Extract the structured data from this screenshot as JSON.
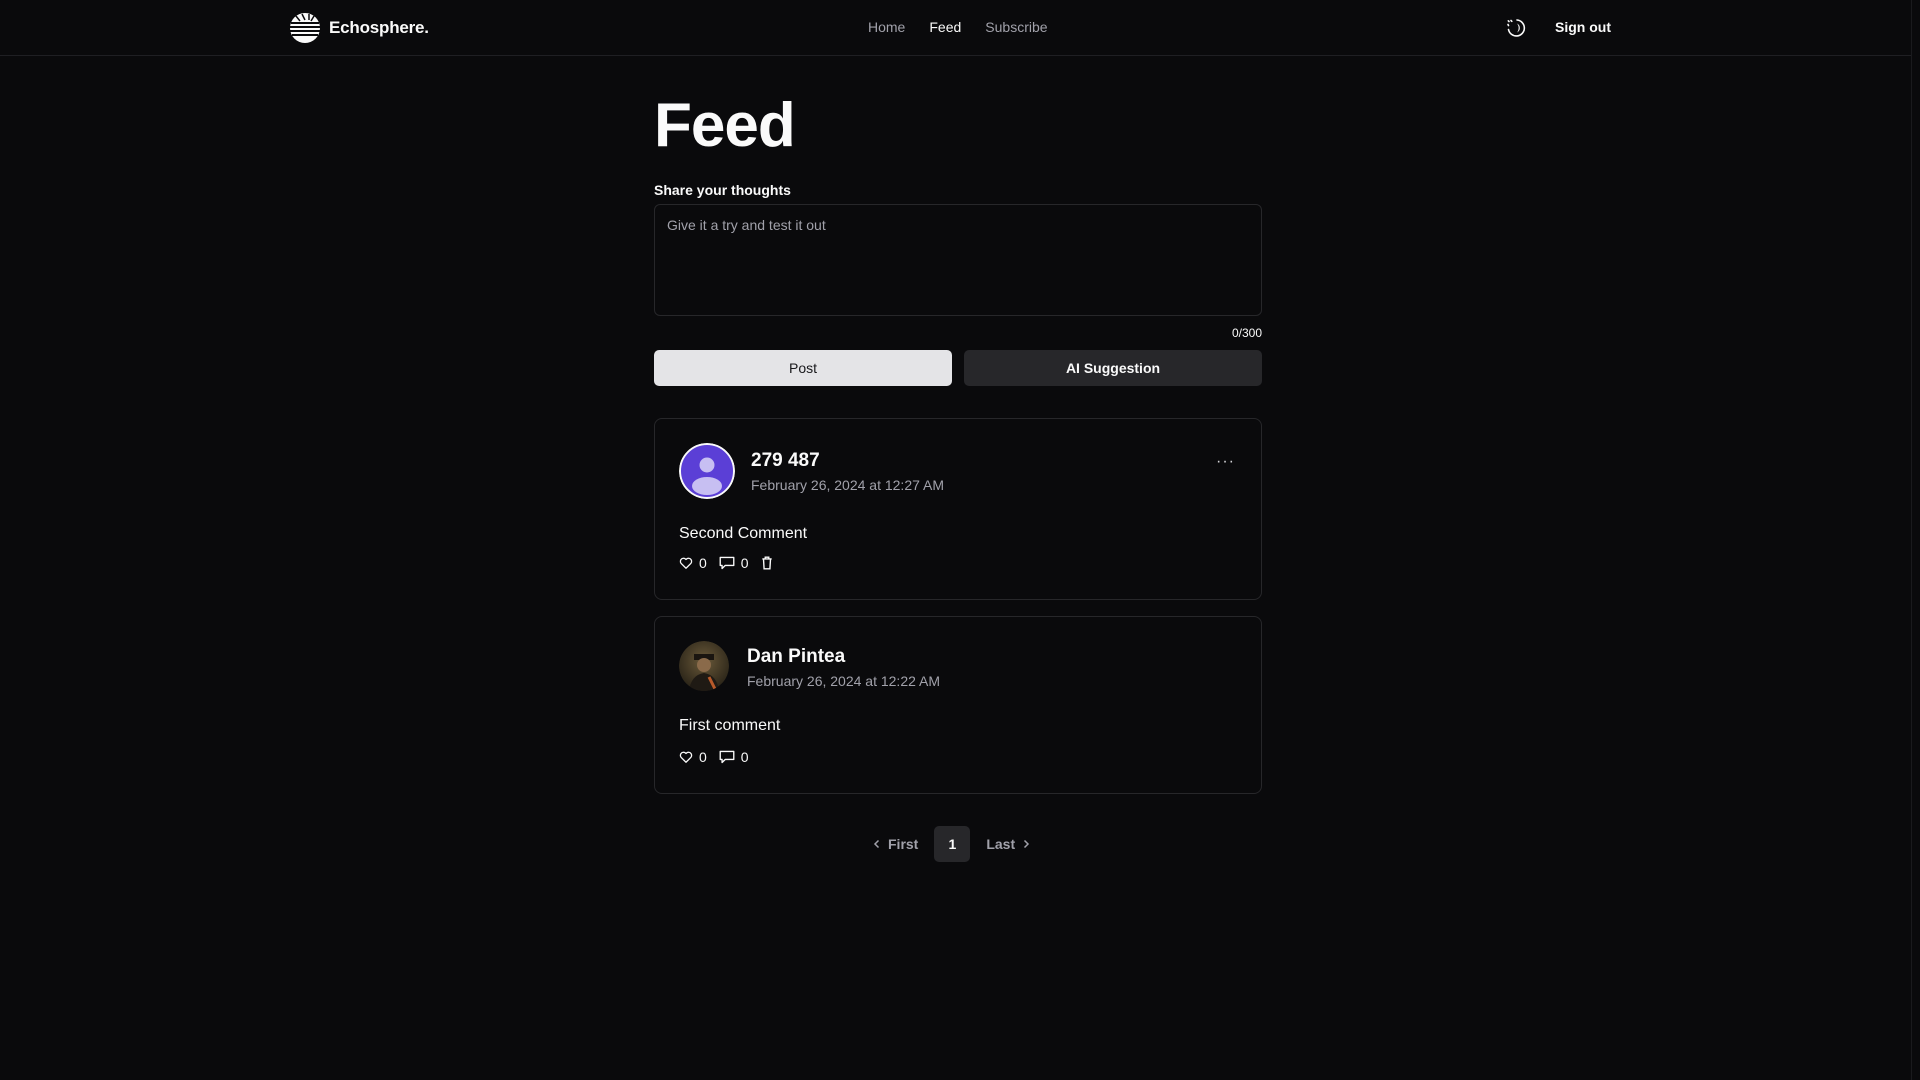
{
  "header": {
    "brand": "Echosphere.",
    "nav": [
      {
        "label": "Home",
        "active": false
      },
      {
        "label": "Feed",
        "active": true
      },
      {
        "label": "Subscribe",
        "active": false
      }
    ],
    "theme_icon": "moon-icon",
    "signout_label": "Sign out"
  },
  "page": {
    "title": "Feed"
  },
  "compose": {
    "label": "Share your thoughts",
    "placeholder": "Give it a try and test it out",
    "value": "",
    "char_count": "0/300",
    "post_label": "Post",
    "ai_label": "AI Suggestion"
  },
  "posts": [
    {
      "author": "279 487",
      "date": "February 26, 2024 at 12:27 AM",
      "body": "Second Comment",
      "likes": "0",
      "comments": "0",
      "avatar": "default-user-avatar",
      "can_delete": true,
      "has_menu": true
    },
    {
      "author": "Dan Pintea",
      "date": "February 26, 2024 at 12:22 AM",
      "body": "First comment",
      "likes": "0",
      "comments": "0",
      "avatar": "photo-avatar",
      "can_delete": false,
      "has_menu": false
    }
  ],
  "pagination": {
    "first_label": "First",
    "current": "1",
    "last_label": "Last"
  },
  "colors": {
    "background": "#0a0a0c",
    "border": "#27272a",
    "muted_text": "#a1a1aa",
    "avatar_purple": "#5b3fd6"
  }
}
